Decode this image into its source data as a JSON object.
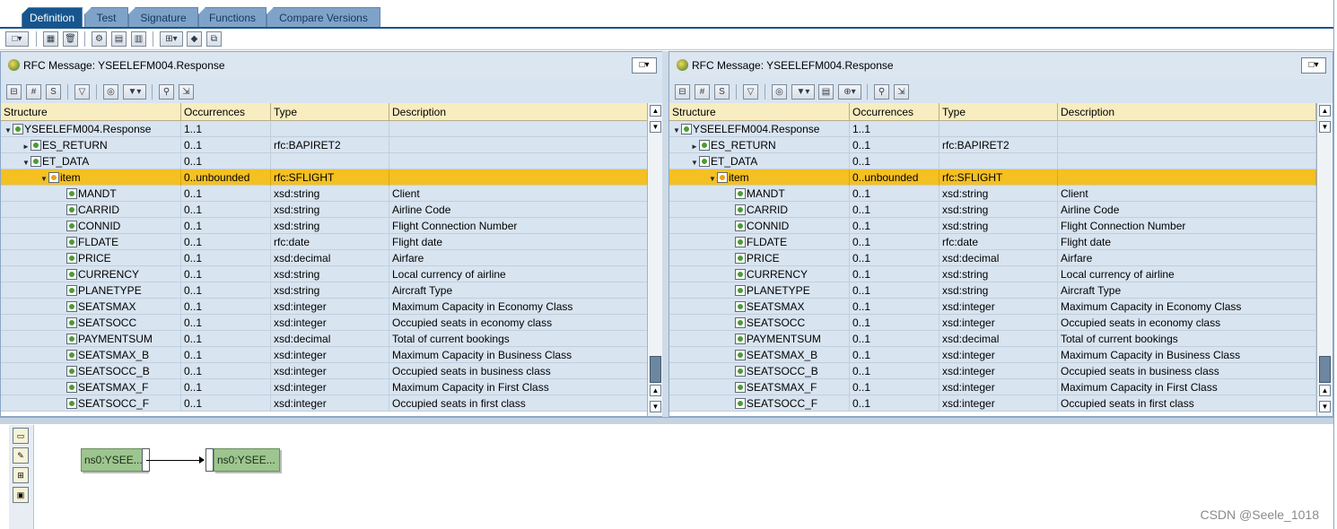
{
  "tabs": [
    "Definition",
    "Test",
    "Signature",
    "Functions",
    "Compare Versions"
  ],
  "panels": [
    {
      "title": "RFC Message: YSEELEFM004.Response"
    },
    {
      "title": "RFC Message: YSEELEFM004.Response"
    }
  ],
  "columns": [
    "Structure",
    "Occurrences",
    "Type",
    "Description"
  ],
  "rows": [
    {
      "expander": "▼",
      "name": "YSEELEFM004.Response",
      "occ": "1..1",
      "type": "",
      "desc": ""
    },
    {
      "expander": "►",
      "name": "ES_RETURN",
      "occ": "0..1",
      "type": "rfc:BAPIRET2",
      "desc": ""
    },
    {
      "expander": "▼",
      "name": "ET_DATA",
      "occ": "0..1",
      "type": "",
      "desc": ""
    },
    {
      "expander": "▼",
      "name": "item",
      "occ": "0..unbounded",
      "type": "rfc:SFLIGHT",
      "desc": ""
    },
    {
      "expander": "",
      "name": "MANDT",
      "occ": "0..1",
      "type": "xsd:string",
      "desc": "Client"
    },
    {
      "expander": "",
      "name": "CARRID",
      "occ": "0..1",
      "type": "xsd:string",
      "desc": "Airline Code"
    },
    {
      "expander": "",
      "name": "CONNID",
      "occ": "0..1",
      "type": "xsd:string",
      "desc": "Flight Connection Number"
    },
    {
      "expander": "",
      "name": "FLDATE",
      "occ": "0..1",
      "type": "rfc:date",
      "desc": "Flight date"
    },
    {
      "expander": "",
      "name": "PRICE",
      "occ": "0..1",
      "type": "xsd:decimal",
      "desc": "Airfare"
    },
    {
      "expander": "",
      "name": "CURRENCY",
      "occ": "0..1",
      "type": "xsd:string",
      "desc": "Local currency of airline"
    },
    {
      "expander": "",
      "name": "PLANETYPE",
      "occ": "0..1",
      "type": "xsd:string",
      "desc": "Aircraft Type"
    },
    {
      "expander": "",
      "name": "SEATSMAX",
      "occ": "0..1",
      "type": "xsd:integer",
      "desc": "Maximum Capacity in Economy Class"
    },
    {
      "expander": "",
      "name": "SEATSOCC",
      "occ": "0..1",
      "type": "xsd:integer",
      "desc": "Occupied seats in economy class"
    },
    {
      "expander": "",
      "name": "PAYMENTSUM",
      "occ": "0..1",
      "type": "xsd:decimal",
      "desc": "Total of current bookings"
    },
    {
      "expander": "",
      "name": "SEATSMAX_B",
      "occ": "0..1",
      "type": "xsd:integer",
      "desc": "Maximum Capacity in Business Class"
    },
    {
      "expander": "",
      "name": "SEATSOCC_B",
      "occ": "0..1",
      "type": "xsd:integer",
      "desc": "Occupied seats in business class"
    },
    {
      "expander": "",
      "name": "SEATSMAX_F",
      "occ": "0..1",
      "type": "xsd:integer",
      "desc": "Maximum Capacity in First Class"
    },
    {
      "expander": "",
      "name": "SEATSOCC_F",
      "occ": "0..1",
      "type": "xsd:integer",
      "desc": "Occupied seats in first class"
    }
  ],
  "selected_row": "item",
  "bottom": {
    "source_box": "ns0:YSEE...",
    "target_box": "ns0:YSEE..."
  },
  "watermark": "CSDN @Seele_1018",
  "colors": {
    "tab_active": "#17558e",
    "row_bg": "#d8e4f0",
    "row_selected": "#f4c022",
    "header_bg": "#f8edc1",
    "message_box": "#9dc58f"
  }
}
